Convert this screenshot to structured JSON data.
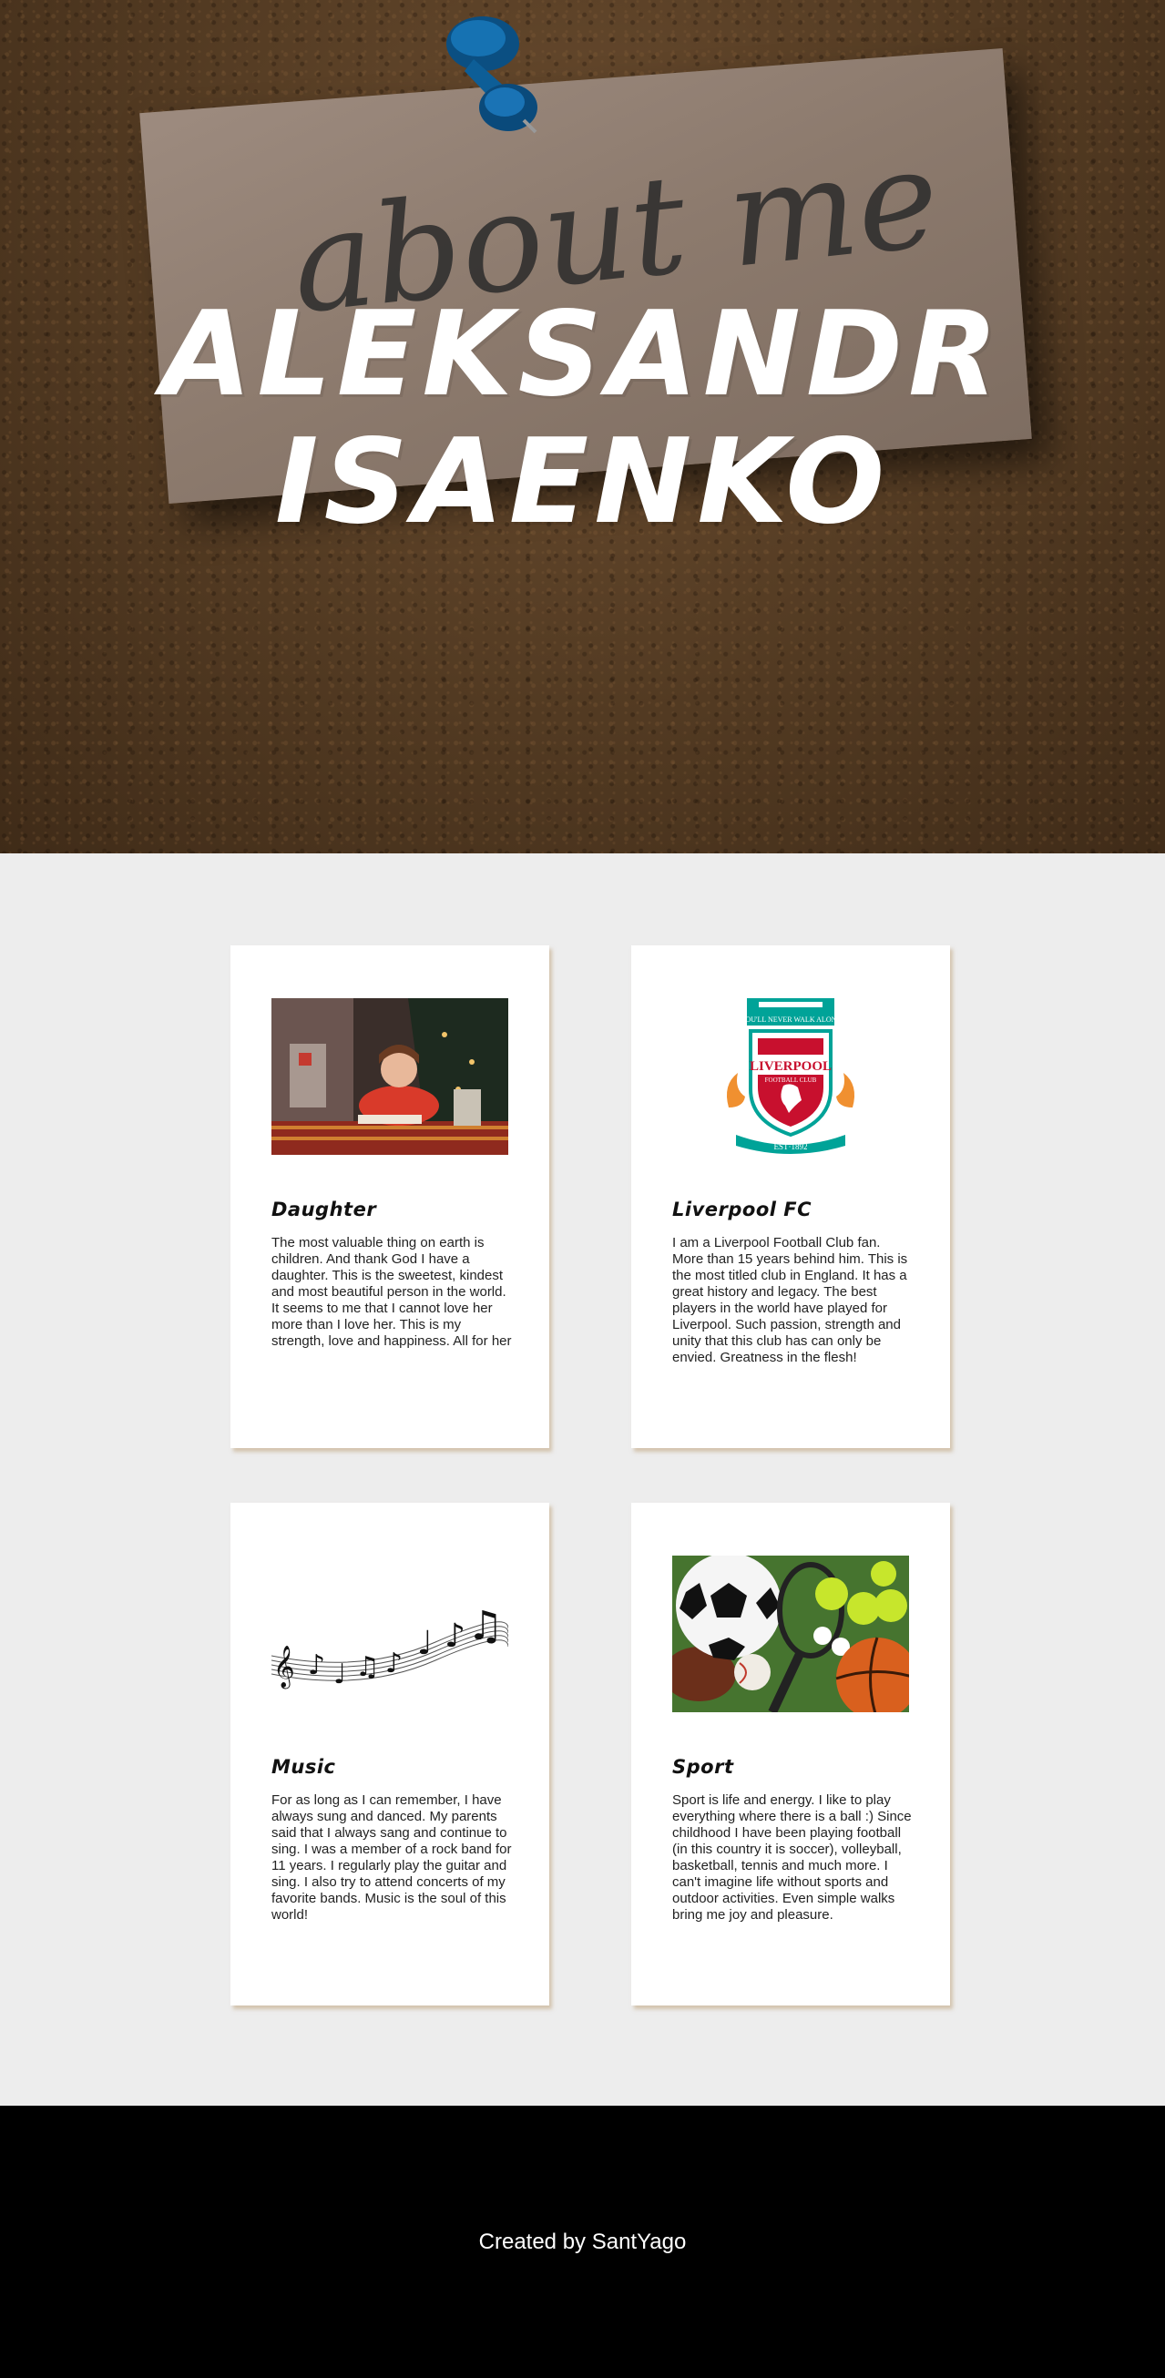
{
  "hero": {
    "note_text": "about me",
    "title_line1": "ALEKSANDR",
    "title_line2": "ISAENKO"
  },
  "cards": [
    {
      "image": "daughter-photo",
      "title": "Daughter",
      "text": "The most valuable thing on earth is children. And thank God I have a daughter. This is the sweetest, kindest and most beautiful person in the world. It seems to me that I cannot love her more than I love her. This is my strength, love and happiness. All for her"
    },
    {
      "image": "liverpool-crest",
      "crest_motto": "YOU'LL NEVER WALK ALONE",
      "crest_name": "LIVERPOOL",
      "crest_sub": "FOOTBALL CLUB",
      "crest_est": "EST·1892",
      "title": "Liverpool FC",
      "text": "I am a Liverpool Football Club fan. More than 15 years behind him. This is the most titled club in England. It has a great history and legacy. The best players in the world have played for Liverpool. Such passion, strength and unity that this club has can only be envied. Greatness in the flesh!"
    },
    {
      "image": "music-notes",
      "title": "Music",
      "text": "For as long as I can remember, I have always sung and danced. My parents said that I always sang and continue to sing. I was a member of a rock band for 11 years. I regularly play the guitar and sing. I also try to attend concerts of my favorite bands. Music is the soul of this world!"
    },
    {
      "image": "sports-balls",
      "title": "Sport",
      "text": "Sport is life and energy. I like to play everything where there is a ball :) Since childhood I have been playing football (in this country it is soccer), volleyball, basketball, tennis and much more. I can't imagine life without sports and outdoor activities. Even simple walks bring me joy and pleasure."
    }
  ],
  "footer": {
    "text": "Created by SantYago"
  },
  "colors": {
    "page_bg": "#ededed",
    "card_bg": "#ffffff",
    "footer_bg": "#000000",
    "cork": "#5a4128",
    "note": "#8c7a6d",
    "pin": "#0d5e97",
    "liverpool_red": "#c8102e",
    "liverpool_teal": "#00a398"
  }
}
